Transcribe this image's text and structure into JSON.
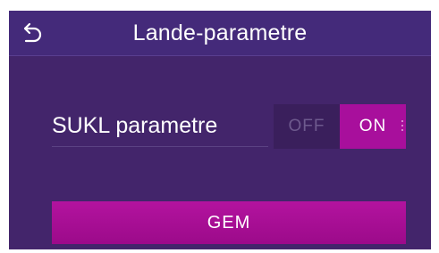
{
  "header": {
    "title": "Lande-parametre",
    "back_icon": "back-arrow-icon"
  },
  "setting": {
    "label": "SUKL parametre",
    "toggle": {
      "off_label": "OFF",
      "on_label": "ON",
      "selected": "ON"
    }
  },
  "actions": {
    "save_label": "GEM"
  },
  "colors": {
    "background": "#43256b",
    "header": "#442a7a",
    "accent": "#a80f9c",
    "toggle_off": "#3a1f5c"
  }
}
